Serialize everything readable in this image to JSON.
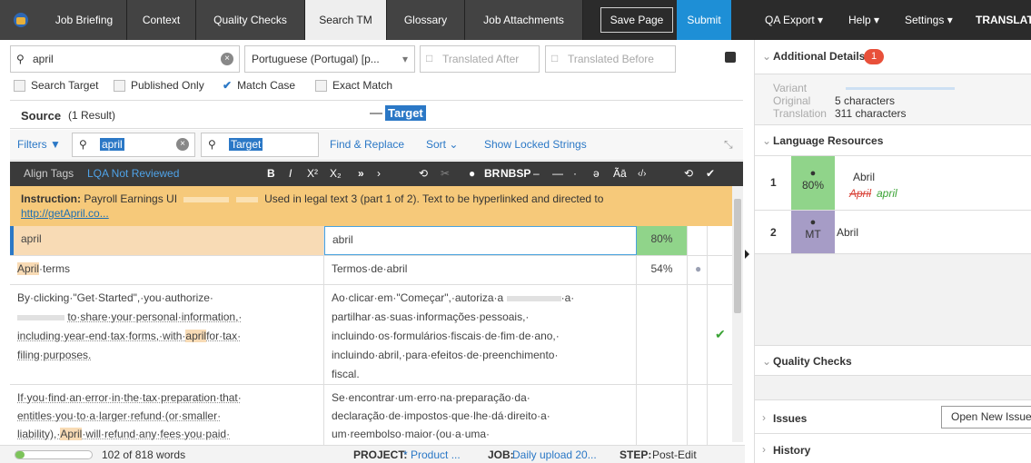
{
  "tabs": [
    "Job Briefing",
    "Context",
    "Quality Checks",
    "Search TM",
    "Glossary",
    "Job Attachments"
  ],
  "top_actions": {
    "save_page": "Save Page",
    "submit": "Submit"
  },
  "top_menus": [
    "QA Export ▾",
    "Help ▾",
    "Settings ▾",
    "TRANSLATOR"
  ],
  "search": {
    "query": "april",
    "language": "Portuguese (Portugal) [p...",
    "translated_after": "Translated After",
    "translated_before": "Translated Before",
    "options": [
      "Search Target",
      "Published Only",
      "Match Case",
      "Exact Match"
    ]
  },
  "source_header": {
    "label": "Source",
    "count": "(1 Result)",
    "target_label": "Target"
  },
  "filterbar": {
    "filters": "Filters",
    "source_query": "april",
    "target_query": "Target",
    "find_replace": "Find & Replace",
    "sort": "Sort ⌄",
    "show_locked": "Show Locked Strings"
  },
  "toolbar": {
    "align_tags": "Align Tags",
    "lqa": "LQA Not Reviewed",
    "tools": [
      "B",
      "I",
      "X²",
      "X₂",
      "»",
      "›",
      "⟲",
      "✂",
      "●",
      "BR",
      "NBSP",
      "–",
      "—",
      "·",
      "ǝ",
      "Ãā",
      "‹/›",
      "⟲",
      "✔"
    ]
  },
  "instruction": {
    "label": "Instruction:",
    "text": "Payroll Earnings UI",
    "tail": "Used in legal text 3 (part 1 of 2). Text to be hyperlinked and directed to",
    "link": "http://getApril.co..."
  },
  "rows": [
    {
      "source": "april",
      "target": "abril",
      "score": "80%"
    },
    {
      "source_a": "April",
      "source_b": "·terms",
      "target": "Termos·de·abril",
      "score": "54%"
    },
    {
      "source_lines": [
        "By·clicking·\"Get·Started\",·you·authorize·",
        "to·share·your·personal·information,·",
        "including·year-end·tax·forms,·with·",
        "for·tax·",
        "filing·purposes."
      ],
      "source_hl": "april",
      "target_lines": [
        "Ao·clicar·em·\"Começar\",·autoriza·a",
        "·a·",
        "partilhar·as·suas·informações·pessoais,·",
        "incluindo·os·formulários·fiscais·de·fim·de·ano,·",
        "incluindo·abril,·para·efeitos·de·preenchimento·",
        "fiscal."
      ]
    },
    {
      "source_lines": [
        "If·you·find·an·error·in·the·tax·preparation·that·",
        "entitles·you·to·a·larger·refund·(or·smaller·",
        "liability),·",
        "·will·refund·any·fees·you·paid·"
      ],
      "source_hl": "April",
      "target_lines": [
        "Se·encontrar·um·erro·na·preparação·da·",
        "declaração·de·impostos·que·lhe·dá·direito·a·",
        "um·reembolso·maior·(ou·a·uma·"
      ]
    }
  ],
  "footer": {
    "words": "102 of 818 words",
    "project_label": "PROJECT:",
    "project_value": "* Product ...",
    "job_label": "JOB:",
    "job_value": "Daily upload 20...",
    "step_label": "STEP:",
    "step_value": "Post-Edit",
    "progress": 0.12
  },
  "right": {
    "additional_details": "Additional Details",
    "details_badge": "1",
    "variant_label": "Variant",
    "original_label": "Original",
    "original_value": "5 characters",
    "translation_label": "Translation",
    "translation_value": "311 characters",
    "language_resources": "Language Resources",
    "resources": [
      {
        "num": "1",
        "score": "80%",
        "text": "Abril",
        "diff_del": "April",
        "diff_ins": "april"
      },
      {
        "num": "2",
        "score": "MT",
        "text": "Abril"
      }
    ],
    "quality_checks": "Quality Checks",
    "issues": "Issues",
    "open_issue": "Open New Issue",
    "history": "History"
  },
  "colors": {
    "accent": "#1e8fd6",
    "tm80": "#90d48a",
    "mt": "#a69cc6",
    "instruction": "#f6c97a",
    "highlight": "#f8dbb5"
  }
}
